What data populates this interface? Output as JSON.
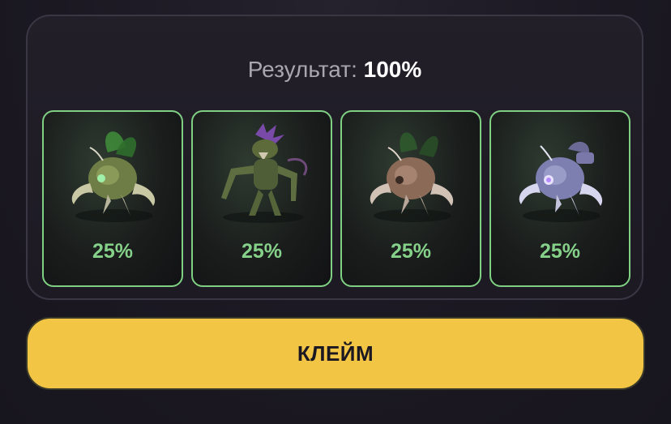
{
  "result": {
    "label": "Результат:",
    "value": "100%"
  },
  "cards": [
    {
      "icon": "green-winged-bug-mech-icon",
      "percent": "25%",
      "accent": "#7fd083"
    },
    {
      "icon": "purple-mantis-mech-icon",
      "percent": "25%",
      "accent": "#7fd083"
    },
    {
      "icon": "copper-bug-mech-icon",
      "percent": "25%",
      "accent": "#7fd083"
    },
    {
      "icon": "blue-bug-mech-icon",
      "percent": "25%",
      "accent": "#7fd083"
    }
  ],
  "claim_button": {
    "label": "КЛЕЙМ",
    "color": "#f2c544"
  },
  "colors": {
    "background": "#1b1822",
    "card_border": "#7fd083",
    "percent_text": "#86d18a"
  }
}
